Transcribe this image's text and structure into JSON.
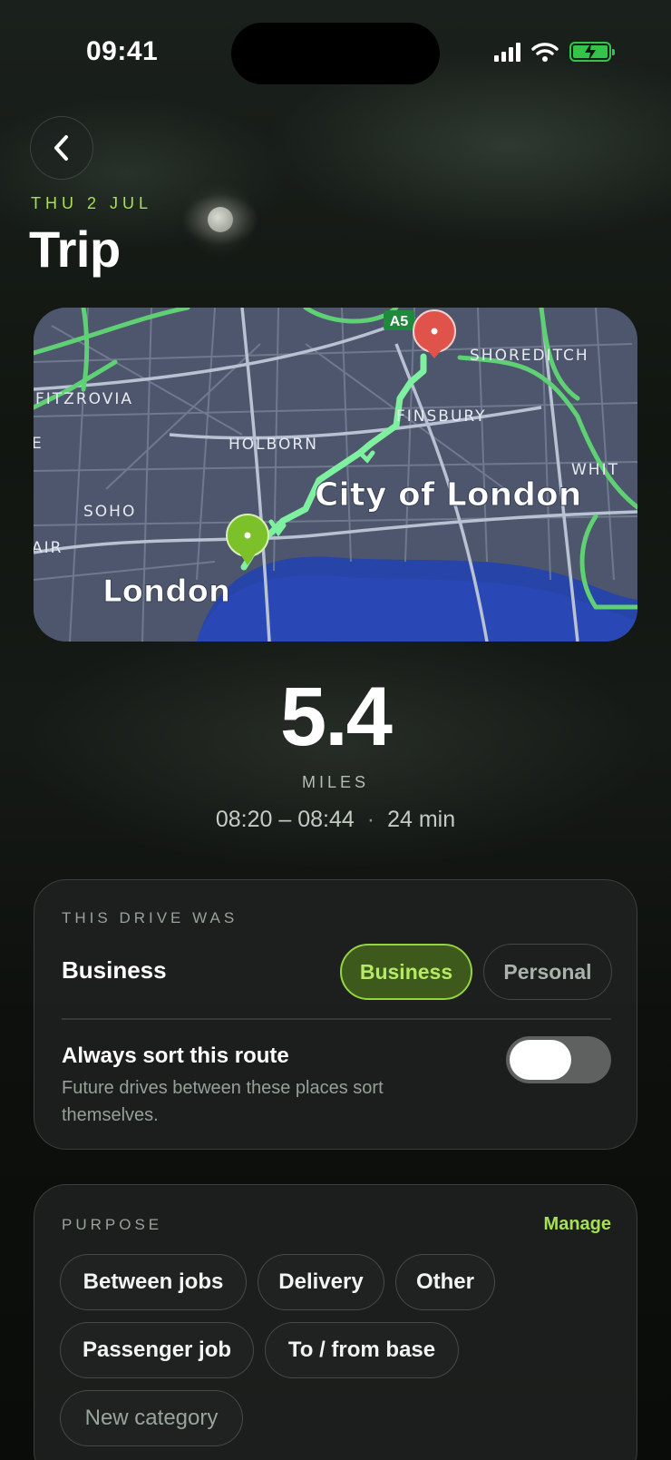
{
  "status_bar": {
    "time": "09:41"
  },
  "header": {
    "date": "THU 2 JUL",
    "title": "Trip"
  },
  "map": {
    "labels": {
      "road_shield": "A5",
      "shoreditch": "SHOREDITCH",
      "fitzrovia": "FITZROVIA",
      "finsbury": "FINSBURY",
      "holborn": "HOLBORN",
      "whit": "WHIT",
      "city": "City of London",
      "soho": "SOHO",
      "air": "AIR",
      "e": "E",
      "london": "London"
    },
    "route_color": "#7ef0a0",
    "start_pin_color": "#7cc02a",
    "end_pin_color": "#e0534a"
  },
  "stats": {
    "distance": "5.4",
    "unit": "MILES",
    "time_range": "08:20 – 08:44",
    "separator": "·",
    "duration": "24 min"
  },
  "drive_card": {
    "label": "THIS DRIVE WAS",
    "value": "Business",
    "options": [
      "Business",
      "Personal"
    ],
    "selected": "Business",
    "sort_title": "Always sort this route",
    "sort_desc": "Future drives between these places sort themselves.",
    "toggle_on": false
  },
  "purpose_card": {
    "label": "PURPOSE",
    "manage": "Manage",
    "chips": [
      "Between jobs",
      "Delivery",
      "Other",
      "Passenger job",
      "To / from base"
    ],
    "new_category": "New category"
  },
  "colors": {
    "accent": "#a7e053",
    "selected_fill": "#3d5a1c",
    "battery": "#35c44a"
  }
}
